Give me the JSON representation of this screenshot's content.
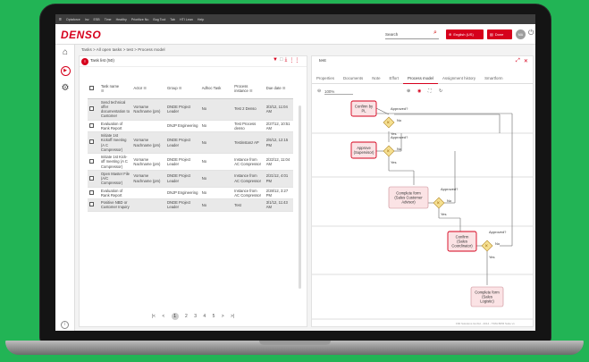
{
  "menubar": [
    "Optaforce",
    "Inv",
    "ESB",
    "Time",
    "Healthy",
    "Prioritize Nu",
    "Bug Tool",
    "Tab",
    "HTI Lean",
    "Help"
  ],
  "header": {
    "logo": "DENSO",
    "search_placeholder": "Search",
    "lang_label": "English (US)",
    "done_label": "Done",
    "avatar_initials": "MA"
  },
  "breadcrumb": "Tasks > All open tasks > test > Process model",
  "task_list": {
    "title": "Task list (50)",
    "columns": [
      "Task name",
      "Actor",
      "Group",
      "Adhoc Task",
      "Process instance",
      "Due date"
    ],
    "rows": [
      {
        "name": "Send technical offer documentation to Customer",
        "actor": "Vorname Nachname (pm)",
        "group": "DNDE Project Leader",
        "adhoc": "No",
        "instance": "Test 2 Denso",
        "due": "3/3/12, 11:04 AM"
      },
      {
        "name": "Evaluation of Rank Report",
        "actor": "",
        "group": "DNJP Engineering",
        "adhoc": "No",
        "instance": "Test Process denso",
        "due": "2/27/12, 10:51 AM"
      },
      {
        "name": "Initiate 1st Kickoff meeting (A C Compressor)",
        "actor": "Vorname Nachname (pm)",
        "group": "DNDE Project Leader",
        "adhoc": "No",
        "instance": "Testinstanz AP",
        "due": "2/6/12, 12:15 PM"
      },
      {
        "name": "Initiate 1st Kick-off meeting (A C Compressor)",
        "actor": "Vorname Nachname (pm)",
        "group": "DNDE Project Leader",
        "adhoc": "No",
        "instance": "Instance from AC Compressor",
        "due": "2/22/12, 11:04 AM"
      },
      {
        "name": "Open Master File (A/C Compressor)",
        "actor": "Vorname Nachname (pm)",
        "group": "DNDE Project Leader",
        "adhoc": "No",
        "instance": "Instance from AC Compressor",
        "due": "2/21/12, 4:01 PM"
      },
      {
        "name": "Evaluation of Rank Report",
        "actor": "",
        "group": "DNJP Engineering",
        "adhoc": "No",
        "instance": "Instance from AC Compressor",
        "due": "2/28/12, 3:27 PM"
      },
      {
        "name": "Positive NBD or Customer Inquiry",
        "actor": "",
        "group": "DNDE Project Leader",
        "adhoc": "No",
        "instance": "Test",
        "due": "3/1/12, 11:43 AM"
      }
    ],
    "pager": {
      "first": "|<",
      "prev": "<",
      "pages": [
        "1",
        "2",
        "3",
        "4",
        "5"
      ],
      "current": "1",
      "next": ">",
      "last": ">|"
    }
  },
  "process_panel": {
    "title": "test",
    "tabs": [
      "Properties",
      "Documents",
      "Note",
      "Effort",
      "Process model",
      "Assignment history",
      "Smartform"
    ],
    "active_tab": "Process model",
    "zoom": "100%",
    "nodes": [
      {
        "id": "n1",
        "lines": [
          "Confirm by",
          "PL"
        ],
        "highlight": true
      },
      {
        "id": "n2",
        "lines": [
          "Approve",
          "(Supervisor)"
        ],
        "highlight": true
      },
      {
        "id": "n3",
        "lines": [
          "Complete form",
          "(Sales Customer",
          "Advisor)"
        ],
        "highlight": false
      },
      {
        "id": "n4",
        "lines": [
          "Confirm",
          "(Sales",
          "Coordinator)"
        ],
        "highlight": true
      },
      {
        "id": "n5",
        "lines": [
          "Complete form",
          "(Sales",
          "Logistic)"
        ],
        "highlight": false
      }
    ],
    "gateway_label": "Approved?",
    "yes_label": "Yes",
    "no_label": "No"
  },
  "statusbar": "FMI Solutions GmbH - 2014 - TIMA BPM Suite v1",
  "colors": {
    "accent": "#d6001c",
    "background": "#22b455",
    "node_fill": "#fbe3e5",
    "gateway": "#f5df8f"
  }
}
